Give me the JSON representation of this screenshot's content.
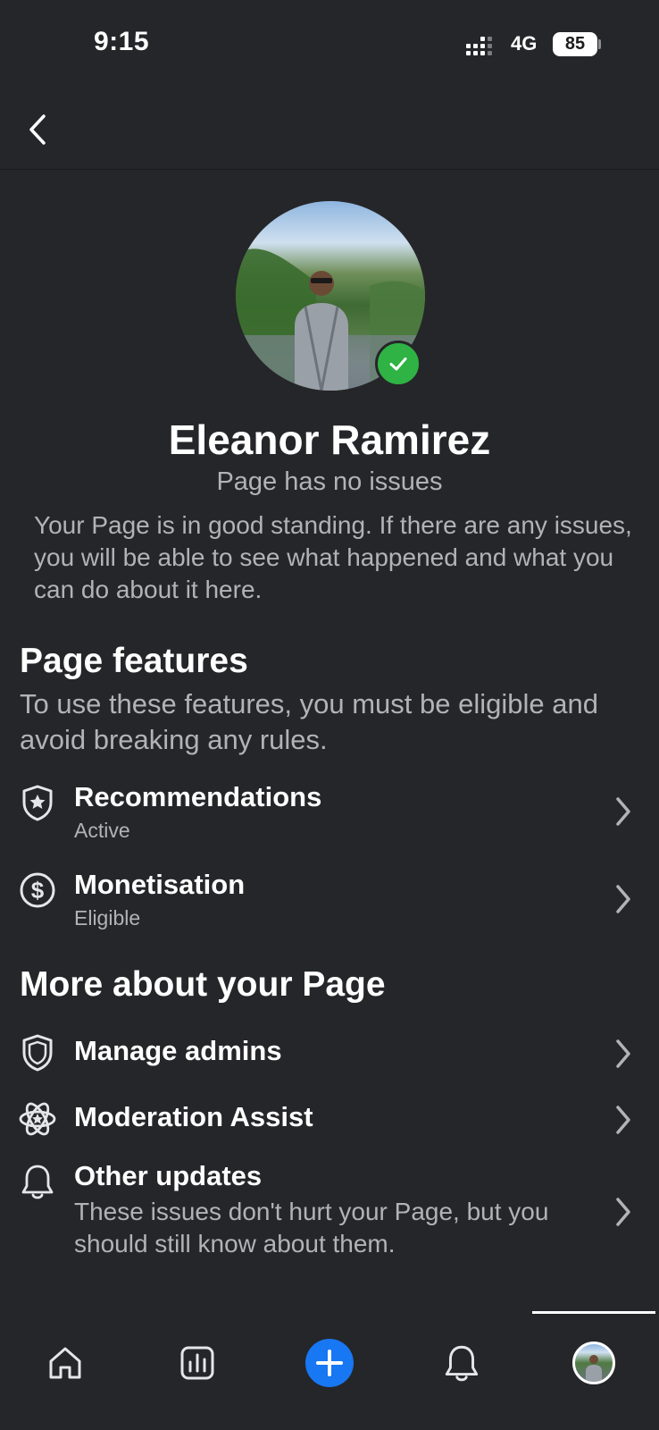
{
  "status_bar": {
    "time": "9:15",
    "network": "4G",
    "battery": "85"
  },
  "profile": {
    "name": "Eleanor Ramirez",
    "status": "Page has no issues",
    "standing_text": "Your Page is in good standing. If there are any issues, you will be able to see what happened and what you can do about it here."
  },
  "page_features": {
    "title": "Page features",
    "description": "To use these features, you must be eligible and avoid breaking any rules.",
    "items": [
      {
        "label": "Recommendations",
        "status": "Active",
        "icon": "shield-star-icon"
      },
      {
        "label": "Monetisation",
        "status": "Eligible",
        "icon": "dollar-circle-icon"
      }
    ]
  },
  "more_about": {
    "title": "More about your Page",
    "items": [
      {
        "label": "Manage admins",
        "icon": "shield-icon"
      },
      {
        "label": "Moderation Assist",
        "icon": "atom-icon"
      },
      {
        "label": "Other updates",
        "description": "These issues don't hurt your Page, but you should still know about them.",
        "icon": "bell-icon"
      }
    ]
  },
  "tab_bar": {
    "items": [
      "home-icon",
      "insights-icon",
      "create-icon",
      "notifications-icon",
      "profile-avatar"
    ],
    "active": "profile-avatar",
    "accent": "#1877f2"
  }
}
